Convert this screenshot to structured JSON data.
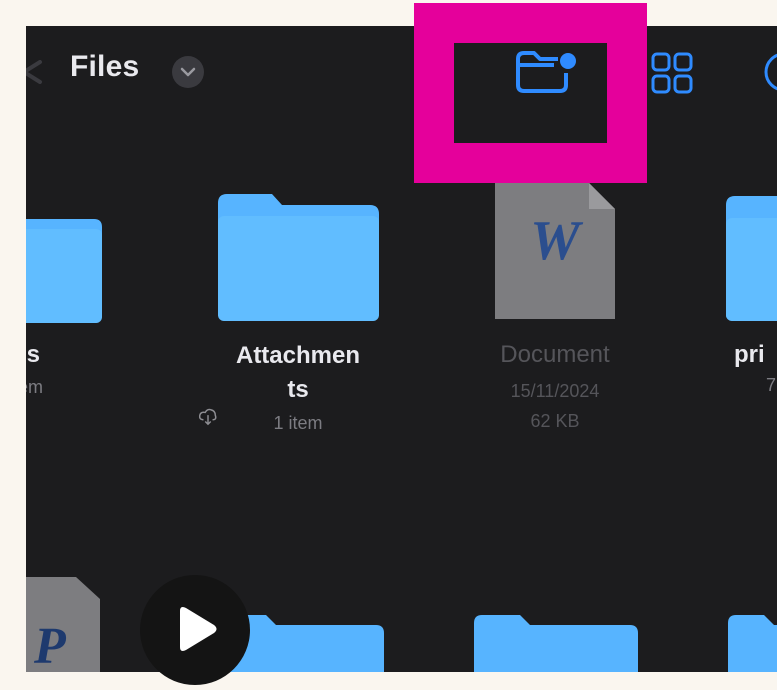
{
  "header": {
    "title": "Files",
    "icons": [
      "back-chevron-icon",
      "chevron-down-icon",
      "new-folder-icon",
      "grid-view-icon",
      "more-options-icon"
    ],
    "accent_color": "#2f8bff"
  },
  "items": [
    {
      "name": "ps",
      "meta1": "item",
      "meta2": "",
      "kind": "folder",
      "cloud": true
    },
    {
      "name_line1": "Attachmen",
      "name_line2": "ts",
      "meta1": "1 item",
      "kind": "folder",
      "cloud": true
    },
    {
      "name": "Document",
      "meta1": "15/11/2024",
      "meta2": "62 KB",
      "kind": "word-document",
      "glyph": "W"
    },
    {
      "name": "pri",
      "meta1": "7",
      "kind": "folder"
    }
  ],
  "second_row": {
    "first_file_glyph": "P",
    "play_icon": "play-icon"
  },
  "highlight": {
    "target": "new-folder-button",
    "color": "#e5009b"
  }
}
